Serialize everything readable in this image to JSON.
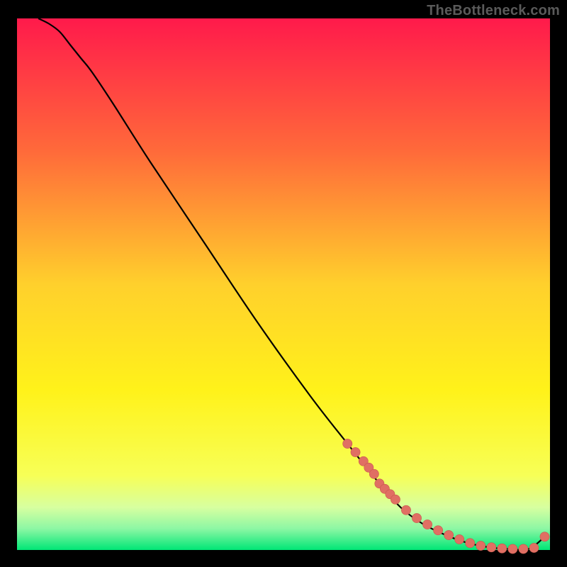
{
  "watermark": "TheBottleneck.com",
  "colors": {
    "background": "#000000",
    "curve": "#000000",
    "marker_fill": "#e06f63",
    "marker_stroke": "#c9584c"
  },
  "chart_data": {
    "type": "line",
    "title": "",
    "xlabel": "",
    "ylabel": "",
    "xlim": [
      0,
      100
    ],
    "ylim": [
      0,
      100
    ],
    "gradient_stops": [
      {
        "offset": 0.0,
        "color": "#ff1a4b"
      },
      {
        "offset": 0.25,
        "color": "#ff6a3a"
      },
      {
        "offset": 0.5,
        "color": "#ffd02c"
      },
      {
        "offset": 0.7,
        "color": "#fff21a"
      },
      {
        "offset": 0.86,
        "color": "#f7ff57"
      },
      {
        "offset": 0.92,
        "color": "#d7ffa0"
      },
      {
        "offset": 0.96,
        "color": "#8cf7a4"
      },
      {
        "offset": 1.0,
        "color": "#00e676"
      }
    ],
    "series": [
      {
        "name": "bottleneck-curve",
        "x": [
          4,
          6,
          8,
          10,
          12,
          14,
          18,
          25,
          35,
          45,
          55,
          62,
          68,
          72,
          76,
          80,
          84,
          88,
          92,
          96,
          99
        ],
        "y": [
          100,
          99,
          97.5,
          95,
          92.5,
          90,
          84,
          73,
          58,
          43,
          29,
          20,
          12.5,
          8,
          5,
          3,
          1.5,
          0.6,
          0.2,
          0.2,
          2.5
        ]
      }
    ],
    "markers": {
      "name": "highlighted-range",
      "x": [
        62,
        63.5,
        65,
        66,
        67,
        68,
        69,
        70,
        71,
        73,
        75,
        77,
        79,
        81,
        83,
        85,
        87,
        89,
        91,
        93,
        95,
        97,
        99
      ],
      "y": [
        20,
        18.4,
        16.7,
        15.5,
        14.3,
        12.5,
        11.5,
        10.5,
        9.5,
        7.5,
        6.0,
        4.8,
        3.7,
        2.8,
        2.0,
        1.3,
        0.8,
        0.5,
        0.3,
        0.2,
        0.2,
        0.4,
        2.5
      ]
    }
  }
}
